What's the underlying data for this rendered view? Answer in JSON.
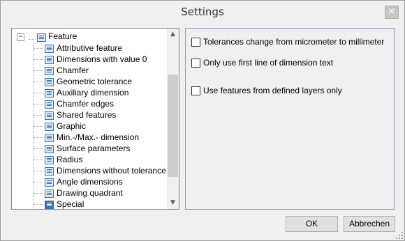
{
  "window": {
    "title": "Settings",
    "close_glyph": "×"
  },
  "tree": {
    "root": {
      "label": "Feature",
      "expanded": true,
      "expander_glyph": "−"
    },
    "items": [
      {
        "label": "Attributive feature",
        "icon": "list-icon"
      },
      {
        "label": "Dimensions with value 0",
        "icon": "list-icon"
      },
      {
        "label": "Chamfer",
        "icon": "list-icon"
      },
      {
        "label": "Geometric tolerance",
        "icon": "list-icon"
      },
      {
        "label": "Auxiliary dimension",
        "icon": "list-icon"
      },
      {
        "label": "Chamfer edges",
        "icon": "list-icon"
      },
      {
        "label": "Shared features",
        "icon": "list-icon"
      },
      {
        "label": "Graphic",
        "icon": "list-icon"
      },
      {
        "label": "Min.-/Max.- dimension",
        "icon": "list-icon"
      },
      {
        "label": "Surface parameters",
        "icon": "list-icon"
      },
      {
        "label": "Radius",
        "icon": "list-icon"
      },
      {
        "label": "Dimensions without tolerance",
        "icon": "list-icon"
      },
      {
        "label": "Angle dimensions",
        "icon": "list-icon"
      },
      {
        "label": "Drawing quadrant",
        "icon": "list-icon"
      },
      {
        "label": "Special",
        "icon": "list-icon-selected"
      }
    ],
    "scroll_up_glyph": "▲",
    "scroll_down_glyph": "▼"
  },
  "options": [
    {
      "label": "Tolerances change from micrometer to millimeter",
      "checked": false
    },
    {
      "label": "Only use first line of dimension text",
      "checked": false
    },
    {
      "label": "Use features from defined layers only",
      "checked": false
    }
  ],
  "buttons": {
    "ok": "OK",
    "cancel": "Abbrechen"
  }
}
